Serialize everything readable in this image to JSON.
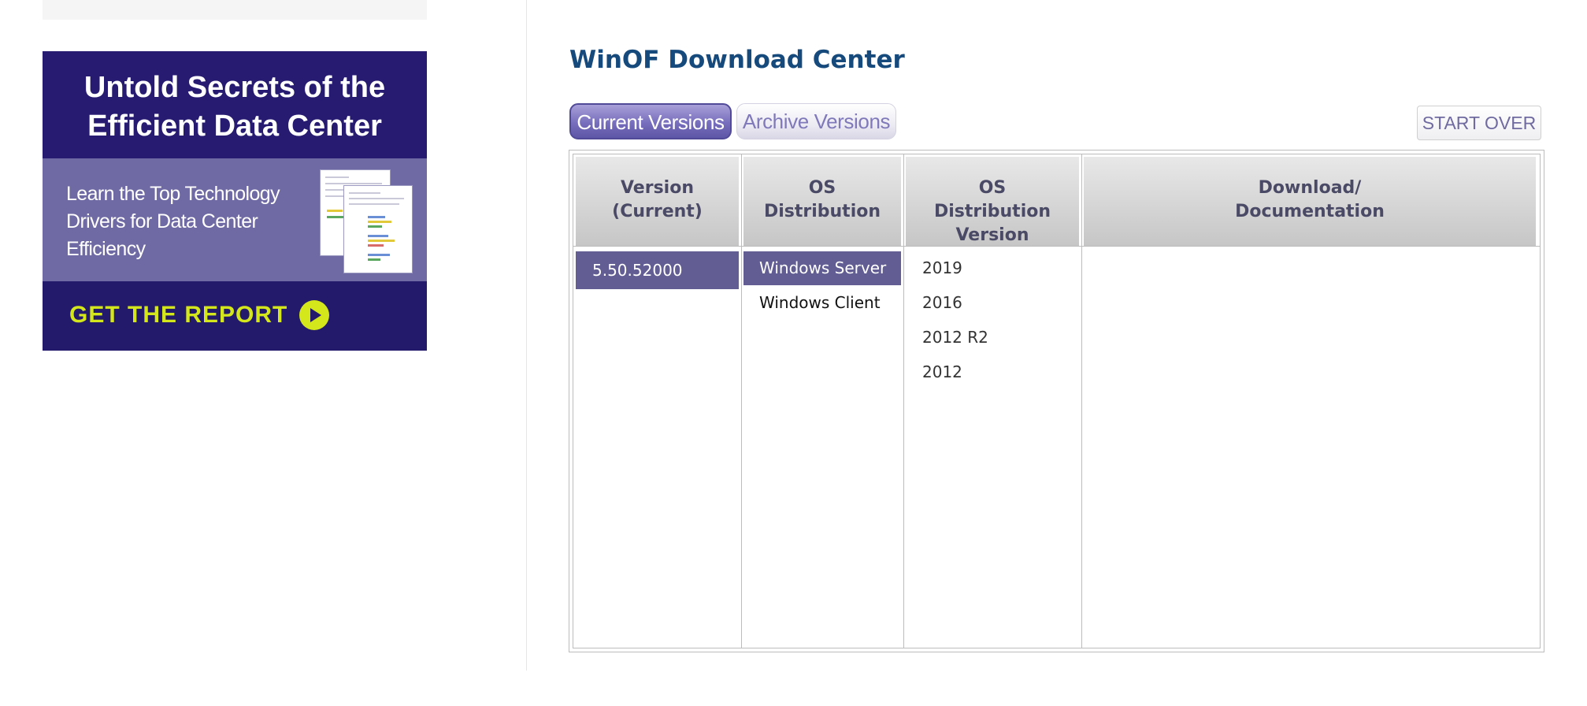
{
  "ad": {
    "headline_line1": "Untold Secrets of the",
    "headline_line2": "Efficient Data Center",
    "body_line1": "Learn the Top Technology",
    "body_line2": "Drivers for Data Center",
    "body_line3": "Efficiency",
    "cta": "GET THE REPORT",
    "icon": "play-circle-icon",
    "colors": {
      "bg": "#23196b",
      "mid": "#6f6aa3",
      "cta": "#d4e71a"
    }
  },
  "page": {
    "title": "WinOF Download Center"
  },
  "tabs": {
    "current": "Current Versions",
    "archive": "Archive Versions",
    "start_over": "START OVER"
  },
  "table": {
    "headers": {
      "version_l1": "Version",
      "version_l2": "(Current)",
      "os_l1": "OS",
      "os_l2": "Distribution",
      "osv_l1": "OS",
      "osv_l2": "Distribution",
      "osv_l3": "Version",
      "dl_l1": "Download/",
      "dl_l2": "Documentation"
    },
    "versions": [
      "5.50.52000"
    ],
    "os_distributions": [
      "Windows Server",
      "Windows Client"
    ],
    "os_versions": [
      "2019",
      "2016",
      "2012 R2",
      "2012"
    ],
    "selected_color": "#625e94"
  }
}
